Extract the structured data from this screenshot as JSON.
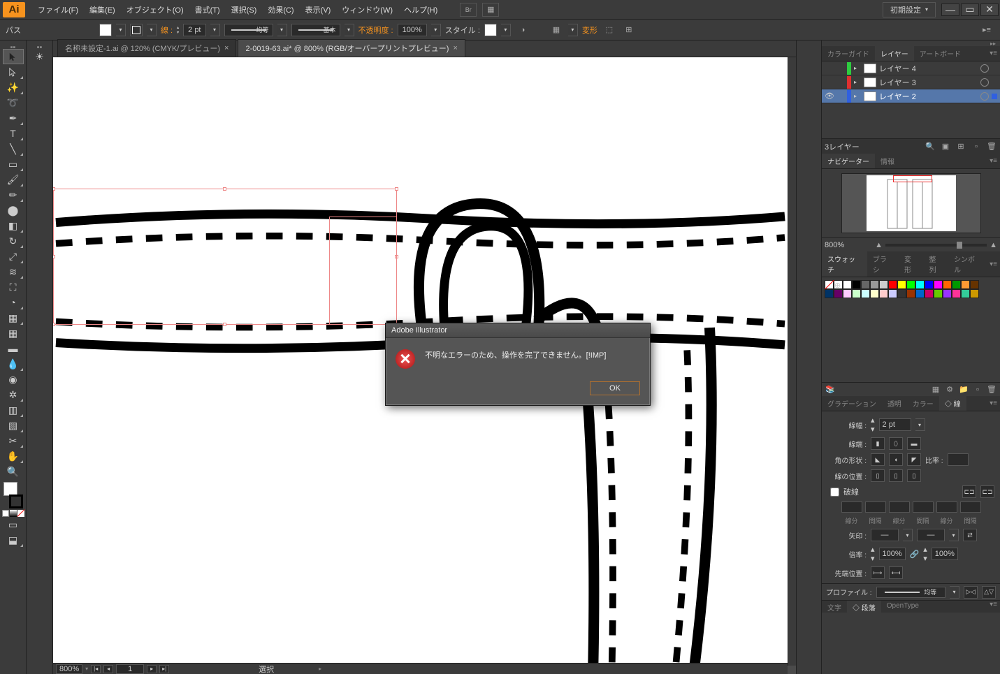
{
  "menubar": {
    "app_badge": "Ai",
    "items": [
      "ファイル(F)",
      "編集(E)",
      "オブジェクト(O)",
      "書式(T)",
      "選択(S)",
      "効果(C)",
      "表示(V)",
      "ウィンドウ(W)",
      "ヘルプ(H)"
    ],
    "bridge_label": "Br",
    "workspace": "初期設定"
  },
  "controlbar": {
    "mode": "パス",
    "stroke_label": "線 :",
    "stroke_weight": "2 pt",
    "stroke_profile": "均等",
    "stroke_brush": "基本",
    "opacity_label": "不透明度 :",
    "opacity": "100%",
    "style_label": "スタイル :",
    "transform": "変形"
  },
  "tabs": [
    {
      "label": "名称未設定-1.ai @ 120% (CMYK/プレビュー)",
      "active": false
    },
    {
      "label": "2-0019-63.ai* @ 800% (RGB/オーバープリントプレビュー)",
      "active": true
    }
  ],
  "dialog": {
    "title": "Adobe Illustrator",
    "message": "不明なエラーのため、操作を完了できません。[!IMP]",
    "ok": "OK"
  },
  "layers_panel": {
    "tabs": [
      "カラーガイド",
      "レイヤー",
      "アートボード"
    ],
    "active_tab": 1,
    "rows": [
      {
        "name": "レイヤー 4",
        "color": "#2ecc40",
        "visible": false,
        "selected": false
      },
      {
        "name": "レイヤー 3",
        "color": "#e03030",
        "visible": false,
        "selected": false
      },
      {
        "name": "レイヤー 2",
        "color": "#3060e0",
        "visible": true,
        "selected": true
      }
    ],
    "footer_count": "3レイヤー"
  },
  "navigator_panel": {
    "tabs": [
      "ナビゲーター",
      "情報"
    ],
    "active_tab": 0,
    "zoom": "800%"
  },
  "swatches_panel": {
    "tabs": [
      "スウォッチ",
      "ブラシ",
      "変形",
      "整列",
      "シンボル"
    ],
    "active_tab": 0,
    "colors": [
      "#ffffff",
      "#000000",
      "#666666",
      "#999999",
      "#cccccc",
      "#ff0000",
      "#ffff00",
      "#00ff00",
      "#00ffff",
      "#0000ff",
      "#ff00ff",
      "#ff6600",
      "#009900",
      "#ff9933",
      "#663300",
      "#003366",
      "#660066",
      "#ffccff",
      "#ccffcc",
      "#ccffff",
      "#ffffcc",
      "#ffcccc",
      "#ccccff",
      "#333333",
      "#993300",
      "#0066cc",
      "#cc0066",
      "#66cc00",
      "#9933ff",
      "#ff3399",
      "#33cc99",
      "#cc9900"
    ]
  },
  "gradient_panel": {
    "tabs": [
      "グラデーション",
      "透明",
      "カラー",
      "◇ 線"
    ],
    "active_tab": 3
  },
  "stroke_panel": {
    "weight_label": "線幅 :",
    "weight": "2 pt",
    "cap_label": "線端 :",
    "corner_label": "角の形状 :",
    "ratio_label": "比率 :",
    "align_label": "線の位置 :",
    "dash_label": "破線",
    "dash_cols": [
      "線分",
      "間隔",
      "線分",
      "間隔",
      "線分",
      "間隔"
    ],
    "arrow_label": "矢印 :",
    "scale_label": "倍率 :",
    "scale1": "100%",
    "scale2": "100%",
    "tip_label": "先端位置 :",
    "profile_label": "プロファイル :",
    "profile": "均等"
  },
  "statusbar": {
    "zoom": "800%",
    "page": "1",
    "tool": "選択"
  },
  "bottom_panel": {
    "tabs": [
      "文字",
      "◇ 段落",
      "OpenType"
    ],
    "active_tab": 1
  }
}
